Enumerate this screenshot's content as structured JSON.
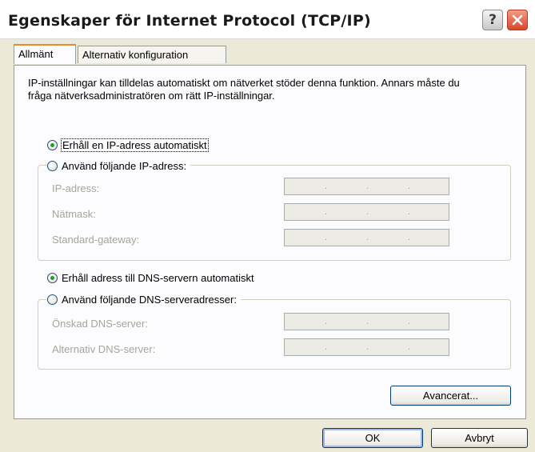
{
  "window": {
    "title": "Egenskaper för Internet Protocol (TCP/IP)",
    "help_label": "?",
    "close_label": "✕"
  },
  "tabs": [
    {
      "label": "Allmänt",
      "active": true
    },
    {
      "label": "Alternativ konfiguration",
      "active": false
    }
  ],
  "description": "IP-inställningar kan tilldelas automatiskt om nätverket stöder denna funktion. Annars måste du fråga nätverksadministratören om rätt IP-inställningar.",
  "ip_options": {
    "auto_label": "Erhåll en IP-adress automatiskt",
    "auto_checked": true,
    "manual_label": "Använd följande IP-adress:",
    "manual_checked": false
  },
  "ip_fields": [
    {
      "label": "IP-adress:",
      "value": ". . ."
    },
    {
      "label": "Nätmask:",
      "value": ". . ."
    },
    {
      "label": "Standard-gateway:",
      "value": ". . ."
    }
  ],
  "dns_options": {
    "auto_label": "Erhåll adress till DNS-servern automatiskt",
    "auto_checked": true,
    "manual_label": "Använd följande DNS-serveradresser:",
    "manual_checked": false
  },
  "dns_fields": [
    {
      "label": "Önskad DNS-server:",
      "value": ". . ."
    },
    {
      "label": "Alternativ DNS-server:",
      "value": ". . ."
    }
  ],
  "buttons": {
    "advanced": "Avancerat...",
    "ok": "OK",
    "cancel": "Avbryt"
  }
}
